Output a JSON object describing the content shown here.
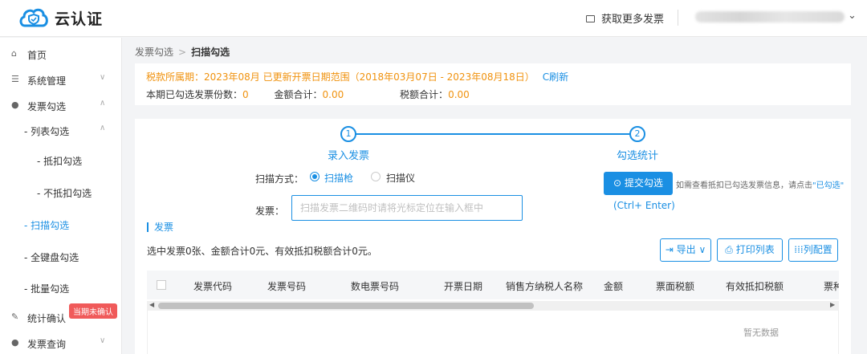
{
  "app": {
    "name": "云认证"
  },
  "header": {
    "more_invoices": "获取更多发票"
  },
  "sidebar": {
    "items": [
      {
        "label": "首页",
        "icon": "home-icon"
      },
      {
        "label": "系统管理",
        "icon": "settings-icon"
      },
      {
        "label": "发票勾选",
        "icon": "check-circle-icon"
      },
      {
        "label": "- 列表勾选"
      },
      {
        "label": "- 抵扣勾选"
      },
      {
        "label": "- 不抵扣勾选"
      },
      {
        "label": "- 扫描勾选"
      },
      {
        "label": "- 全键盘勾选"
      },
      {
        "label": "- 批量勾选"
      },
      {
        "label": "统计确认",
        "icon": "edit-icon"
      },
      {
        "label": "发票查询",
        "icon": "search-icon"
      }
    ],
    "badge": "当期未确认"
  },
  "breadcrumb": {
    "parent": "发票勾选",
    "current": "扫描勾选"
  },
  "notice": {
    "period_line": "税款所属期：2023年08月 已更新开票日期范围（2018年03月07日 - 2023年08月18日）",
    "refresh": "C刷新",
    "count_label": "本期已勾选发票份数：",
    "count_value": "0",
    "amount_label": "金额合计：",
    "amount_value": "0.00",
    "tax_label": "税额合计：",
    "tax_value": "0.00"
  },
  "steps": [
    {
      "num": "1",
      "label": "录入发票"
    },
    {
      "num": "2",
      "label": "勾选统计"
    }
  ],
  "form": {
    "scan_label": "扫描方式：",
    "option_gun": "扫描枪",
    "option_scanner": "扫描仪",
    "selected": "扫描枪",
    "invoice_label": "发票：",
    "invoice_placeholder": "扫描发票二维码时请将光标定位在输入框中"
  },
  "actions": {
    "submit": "提交勾选",
    "hint_prefix": "如需查看抵扣已勾选发票信息，请点击",
    "hint_link": "\"已勾选\"",
    "shortcut": "(Ctrl+ Enter)"
  },
  "table_section": {
    "title": "发票",
    "summary": "选中发票0张、金额合计0元、有效抵扣税额合计0元。",
    "export": "导出",
    "print": "打印列表",
    "columns_config": "列配置",
    "columns": [
      "发票代码",
      "发票号码",
      "数电票号码",
      "开票日期",
      "销售方纳税人名称",
      "金额",
      "票面税额",
      "有效抵扣税额",
      "票种"
    ],
    "empty_text": "暂无数据"
  },
  "colors": {
    "accent": "#1a8fe3",
    "warning": "#f0920e",
    "badge": "#f05a5a"
  }
}
